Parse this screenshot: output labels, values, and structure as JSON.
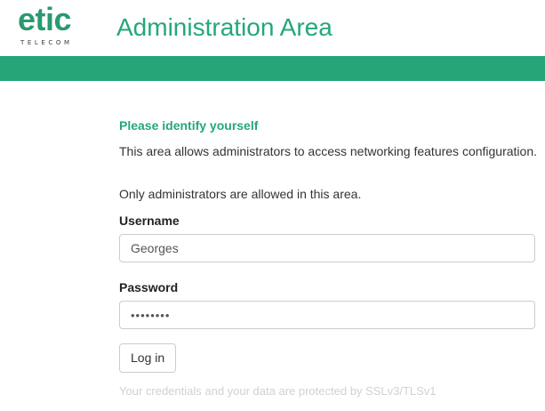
{
  "header": {
    "logo_text": "etic",
    "logo_subtext": "TELECOM",
    "title": "Administration Area"
  },
  "colors": {
    "brand_green": "#25a578",
    "title_green": "#24a77a",
    "footer_note": "#cfd2d2"
  },
  "login": {
    "section_title": "Please identify yourself",
    "description": "This area allows administrators to access networking features configuration.",
    "restriction": "Only administrators are allowed in this area.",
    "username_label": "Username",
    "username_value": "Georges",
    "password_label": "Password",
    "password_value": "12345678",
    "login_button": "Log in",
    "security_note": "Your credentials and your data are protected by SSLv3/TLSv1"
  }
}
